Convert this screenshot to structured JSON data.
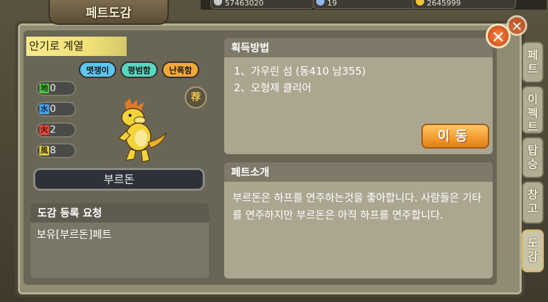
{
  "header": {
    "title": "페트도감"
  },
  "resources": [
    {
      "value": "57463020",
      "icon": "silver-coin-icon",
      "color": "#c9c9c9"
    },
    {
      "value": "19",
      "icon": "crystal-icon",
      "color": "#8fb7e8"
    },
    {
      "value": "2645999",
      "icon": "gold-coin-icon",
      "color": "#f2c233"
    }
  ],
  "pet": {
    "location": "안기로 계열",
    "tags": [
      {
        "label": "맷쟁이",
        "color": "#5cc6f0"
      },
      {
        "label": "평범함",
        "color": "#57d7c0"
      },
      {
        "label": "난폭함",
        "color": "#f2a83a"
      }
    ],
    "stats": [
      {
        "element": "地",
        "value": "0",
        "color": "#55c243"
      },
      {
        "element": "水",
        "value": "0",
        "color": "#4aa5e8"
      },
      {
        "element": "火",
        "value": "2",
        "color": "#e04a3a"
      },
      {
        "element": "風",
        "value": "8",
        "color": "#e6d046"
      }
    ],
    "recommend": "荐",
    "name": "부르돈"
  },
  "request": {
    "title": "도감 등록 요청",
    "text": "보유[부르돈]페트"
  },
  "acquire": {
    "title": "획득방법",
    "items": [
      "1、가우린 섬 (동410 남355)",
      "2、오형제 클리어"
    ],
    "move_label": "이동"
  },
  "intro": {
    "title": "페트소개",
    "text": "부르돈은 하프를 연주하는것을 좋아합니다. 사람들은 기타를 연주하지만 부르돈은 아직 하프를 연주합니다."
  },
  "side_tabs": [
    {
      "label": "페트"
    },
    {
      "label": "이펙트"
    },
    {
      "label": "탑승"
    },
    {
      "label": "창고"
    },
    {
      "label": "도감"
    }
  ]
}
